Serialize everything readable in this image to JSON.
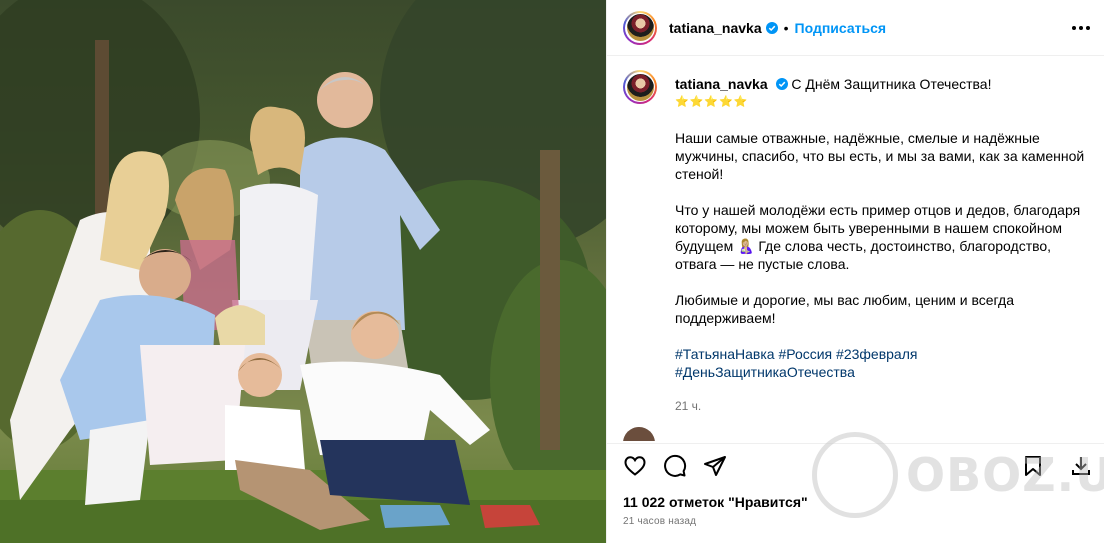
{
  "post": {
    "username": "tatiana_navka",
    "follow_label": "Подписаться",
    "separator": "•"
  },
  "caption": {
    "username": "tatiana_navka",
    "title": "С Днём Защитника Отечества!",
    "stars": "⭐⭐⭐⭐⭐",
    "paragraph1": "Наши самые отважные, надёжные, смелые и надёжные мужчины, спасибо, что вы есть, и мы за вами, как за каменной стеной!",
    "paragraph2": "Что у нашей молодёжи есть пример отцов и дедов, благодаря которому, мы можем быть уверенными в нашем спокойном будущем 🤱🏼 Где слова честь, достоинство, благородство, отвага — не пустые слова.",
    "paragraph3": "Любимые и дорогие, мы вас любим, ценим и всегда поддерживаем!",
    "hashtags": [
      "#ТатьянаНавка",
      "#Россия",
      "#23февраля",
      "#ДеньЗащитникаОтечества"
    ],
    "time": "21 ч."
  },
  "actions": {
    "likes": "11 022 отметок \"Нравится\"",
    "time_ago": "21 часов назад"
  },
  "watermark": {
    "text": "OBOZ.UA"
  },
  "icons": [
    "verified-badge-icon",
    "more-options-icon",
    "heart-icon",
    "comment-icon",
    "share-icon",
    "save-bookmark-icon",
    "download-icon"
  ],
  "colors": {
    "accent": "#0095f6",
    "hashtag": "#00376b",
    "muted": "#737373"
  }
}
